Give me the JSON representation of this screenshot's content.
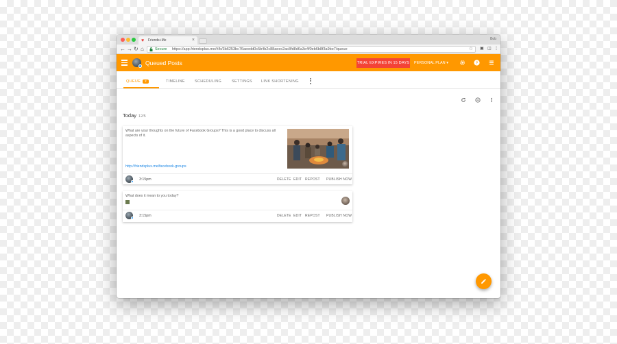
{
  "browser": {
    "tab_title": "Friends+Me",
    "window_user": "Bob",
    "secure_label": "Secure",
    "url": "https://app.friendsplus.me/#/b/3b6253bc76aeedd0c5b4b2c88aeec2ac8fd8d6a3e4f0eb6b8f3a9be7/queue"
  },
  "app": {
    "title": "Queued Posts",
    "trial_banner": "TRIAL EXPIRES IN 15 DAYS",
    "account_name": "PERSONAL PLAN",
    "accent_color": "#ff9800",
    "trial_color": "#f44336"
  },
  "tabs": [
    {
      "label": "QUEUE",
      "badge": "2"
    },
    {
      "label": "TIMELINE"
    },
    {
      "label": "SCHEDULING"
    },
    {
      "label": "SETTINGS"
    },
    {
      "label": "LINK SHORTENING"
    }
  ],
  "day": {
    "heading": "Today",
    "sub": "12/5"
  },
  "posts": [
    {
      "text": "What are your thoughts on the future of Facebook Groups? This is a good place to discuss all aspects of it.",
      "link": "http://friendsplus.me/facebook-groups",
      "time": "3:15pm",
      "actions": [
        "DELETE",
        "EDIT",
        "REPOST",
        "PUBLISH NOW"
      ]
    },
    {
      "text": "What does it mean to you today?",
      "time": "3:15pm",
      "actions": [
        "DELETE",
        "EDIT",
        "REPOST",
        "PUBLISH NOW"
      ]
    }
  ],
  "icons": {
    "menu": "menu-icon",
    "settings": "gear-icon",
    "help": "help-icon",
    "list": "list-icon",
    "refresh": "refresh-icon",
    "pause": "pause-icon",
    "more": "more-vert-icon",
    "compose": "pencil-icon"
  }
}
